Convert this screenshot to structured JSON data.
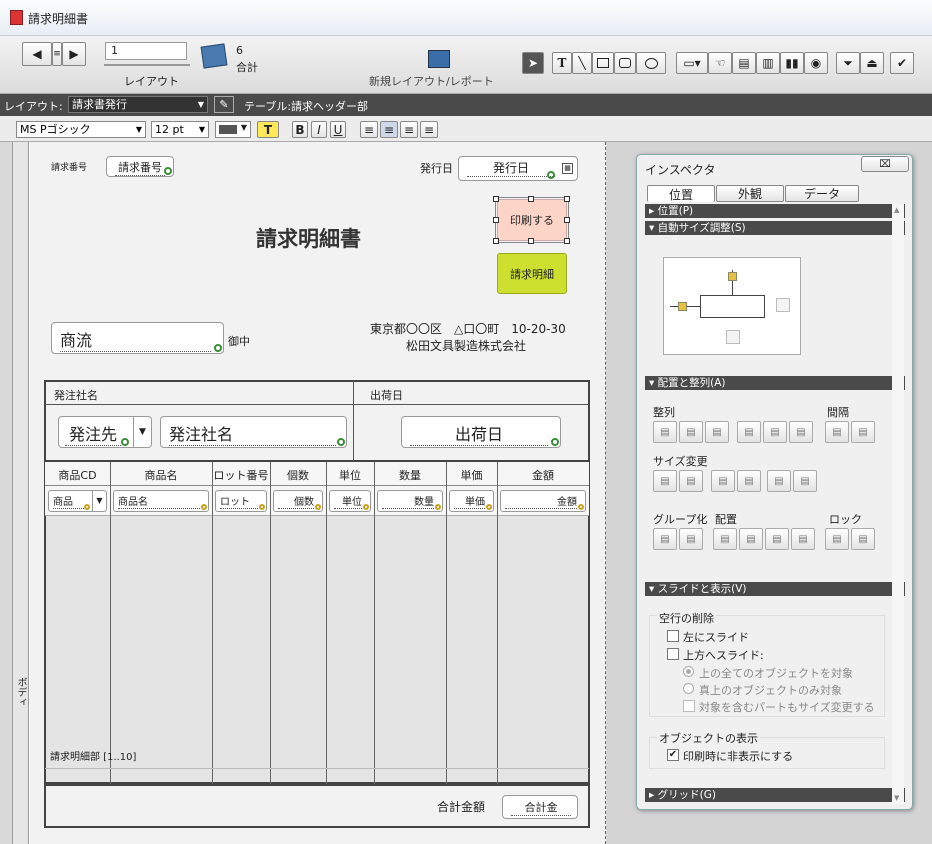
{
  "window": {
    "title": "請求明細書"
  },
  "toolbar": {
    "record_value": "1",
    "layout_label": "レイアウト",
    "count": "6",
    "count_label": "合計",
    "new_layout_label": "新規レイアウト/レポート",
    "text_tool": "T"
  },
  "layoutbar": {
    "layout_prefix": "レイアウト:",
    "layout_name": "請求書発行",
    "table_label": "テーブル:請求ヘッダー部"
  },
  "fontbar": {
    "font": "MS Pゴシック",
    "size": "12 pt",
    "text_color_label": "T",
    "bold": "B",
    "italic": "I",
    "underline": "U"
  },
  "part": {
    "label": "ボディ"
  },
  "form": {
    "invoice_no_label": "請求番号",
    "invoice_no_field": "請求番号",
    "issue_date_label": "発行日",
    "issue_date_field": "発行日",
    "print_button": "印刷する",
    "detail_button": "請求明細",
    "title": "請求明細書",
    "customer_field": "商流",
    "customer_suffix": "御中",
    "address": "東京都〇〇区　△口〇町　10-20-30",
    "company": "松田文具製造株式会社",
    "orderer_label": "発注社名",
    "ship_date_label": "出荷日",
    "orderer_code_field": "発注先",
    "orderer_name_field": "発注社名",
    "ship_date_field": "出荷日",
    "columns": [
      "商品CD",
      "商品名",
      "ロット番号",
      "個数",
      "単位",
      "数量",
      "単価",
      "金額"
    ],
    "row_fields": [
      "商品",
      "商品名",
      "ロット",
      "個数",
      "単位",
      "数量",
      "単価",
      "金額"
    ],
    "portal_label": "請求明細部 [1..10]",
    "total_label": "合計金額",
    "total_field": "合計金"
  },
  "inspector": {
    "title": "インスペクタ",
    "close": "⌧",
    "tabs": [
      "位置",
      "外観",
      "データ"
    ],
    "sections": {
      "position": "位置(P)",
      "autosize": "自動サイズ調整(S)",
      "arrange": "配置と整列(A)",
      "slide": "スライドと表示(V)",
      "grid": "グリッド(G)"
    },
    "align_label": "整列",
    "spacing_label": "間隔",
    "resize_label": "サイズ変更",
    "group_label": "グループ化",
    "arrange_label": "配置",
    "lock_label": "ロック",
    "remove_blank_label": "空行の削除",
    "slide_left": "左にスライド",
    "slide_up": "上方へスライド:",
    "opt_all_above": "上の全てのオブジェクトを対象",
    "opt_directly_above": "真上のオブジェクトのみ対象",
    "resize_enclosing": "対象を含むパートもサイズ変更する",
    "object_display_label": "オブジェクトの表示",
    "hide_when_printing": "印刷時に非表示にする"
  }
}
